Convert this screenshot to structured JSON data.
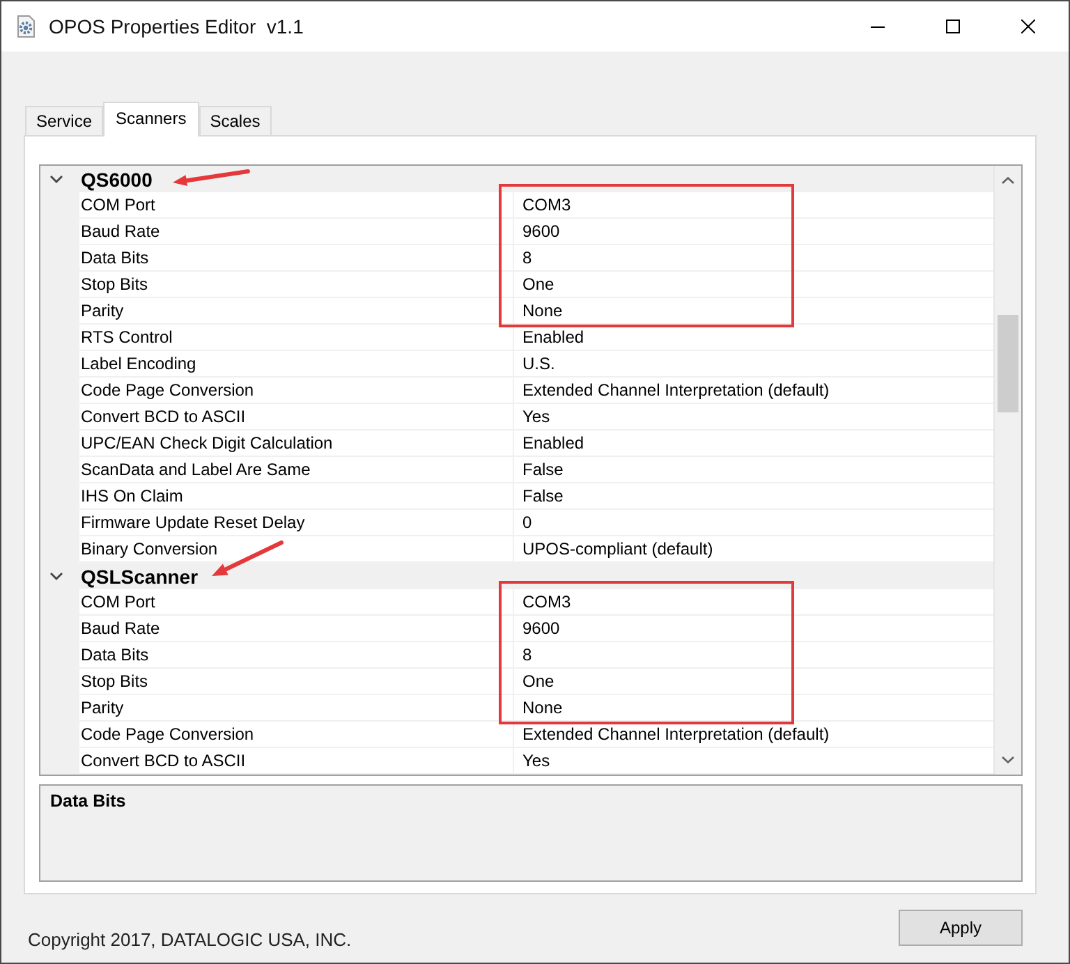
{
  "window": {
    "title": "OPOS Properties Editor  v1.1"
  },
  "tabs": [
    {
      "label": "Service",
      "selected": false
    },
    {
      "label": "Scanners",
      "selected": true
    },
    {
      "label": "Scales",
      "selected": false
    }
  ],
  "property_grid": {
    "categories": [
      {
        "name": "QS6000",
        "expanded": true,
        "arrow": true,
        "properties": [
          {
            "name": "COM Port",
            "value": "COM3",
            "highlighted": true
          },
          {
            "name": "Baud Rate",
            "value": "9600",
            "highlighted": true
          },
          {
            "name": "Data Bits",
            "value": "8",
            "highlighted": true
          },
          {
            "name": "Stop Bits",
            "value": "One",
            "highlighted": true
          },
          {
            "name": "Parity",
            "value": "None",
            "highlighted": true
          },
          {
            "name": "RTS Control",
            "value": "Enabled",
            "highlighted": false
          },
          {
            "name": "Label Encoding",
            "value": "U.S.",
            "highlighted": false
          },
          {
            "name": "Code Page Conversion",
            "value": "Extended Channel Interpretation (default)",
            "highlighted": false
          },
          {
            "name": "Convert BCD to ASCII",
            "value": "Yes",
            "highlighted": false
          },
          {
            "name": "UPC/EAN Check Digit Calculation",
            "value": "Enabled",
            "highlighted": false
          },
          {
            "name": "ScanData and Label Are Same",
            "value": "False",
            "highlighted": false
          },
          {
            "name": "IHS On Claim",
            "value": "False",
            "highlighted": false
          },
          {
            "name": "Firmware Update Reset Delay",
            "value": "0",
            "highlighted": false
          },
          {
            "name": "Binary Conversion",
            "value": "UPOS-compliant (default)",
            "highlighted": false
          }
        ]
      },
      {
        "name": "QSLScanner",
        "expanded": true,
        "arrow": true,
        "properties": [
          {
            "name": "COM Port",
            "value": "COM3",
            "highlighted": true
          },
          {
            "name": "Baud Rate",
            "value": "9600",
            "highlighted": true
          },
          {
            "name": "Data Bits",
            "value": "8",
            "highlighted": true
          },
          {
            "name": "Stop Bits",
            "value": "One",
            "highlighted": true
          },
          {
            "name": "Parity",
            "value": "None",
            "highlighted": true
          },
          {
            "name": "Code Page Conversion",
            "value": "Extended Channel Interpretation (default)",
            "highlighted": false
          },
          {
            "name": "Convert BCD to ASCII",
            "value": "Yes",
            "highlighted": false
          }
        ]
      }
    ]
  },
  "description": {
    "title": "Data Bits"
  },
  "footer": {
    "copyright": "Copyright 2017, DATALOGIC USA, INC."
  },
  "buttons": [
    {
      "label": "Apply"
    }
  ]
}
